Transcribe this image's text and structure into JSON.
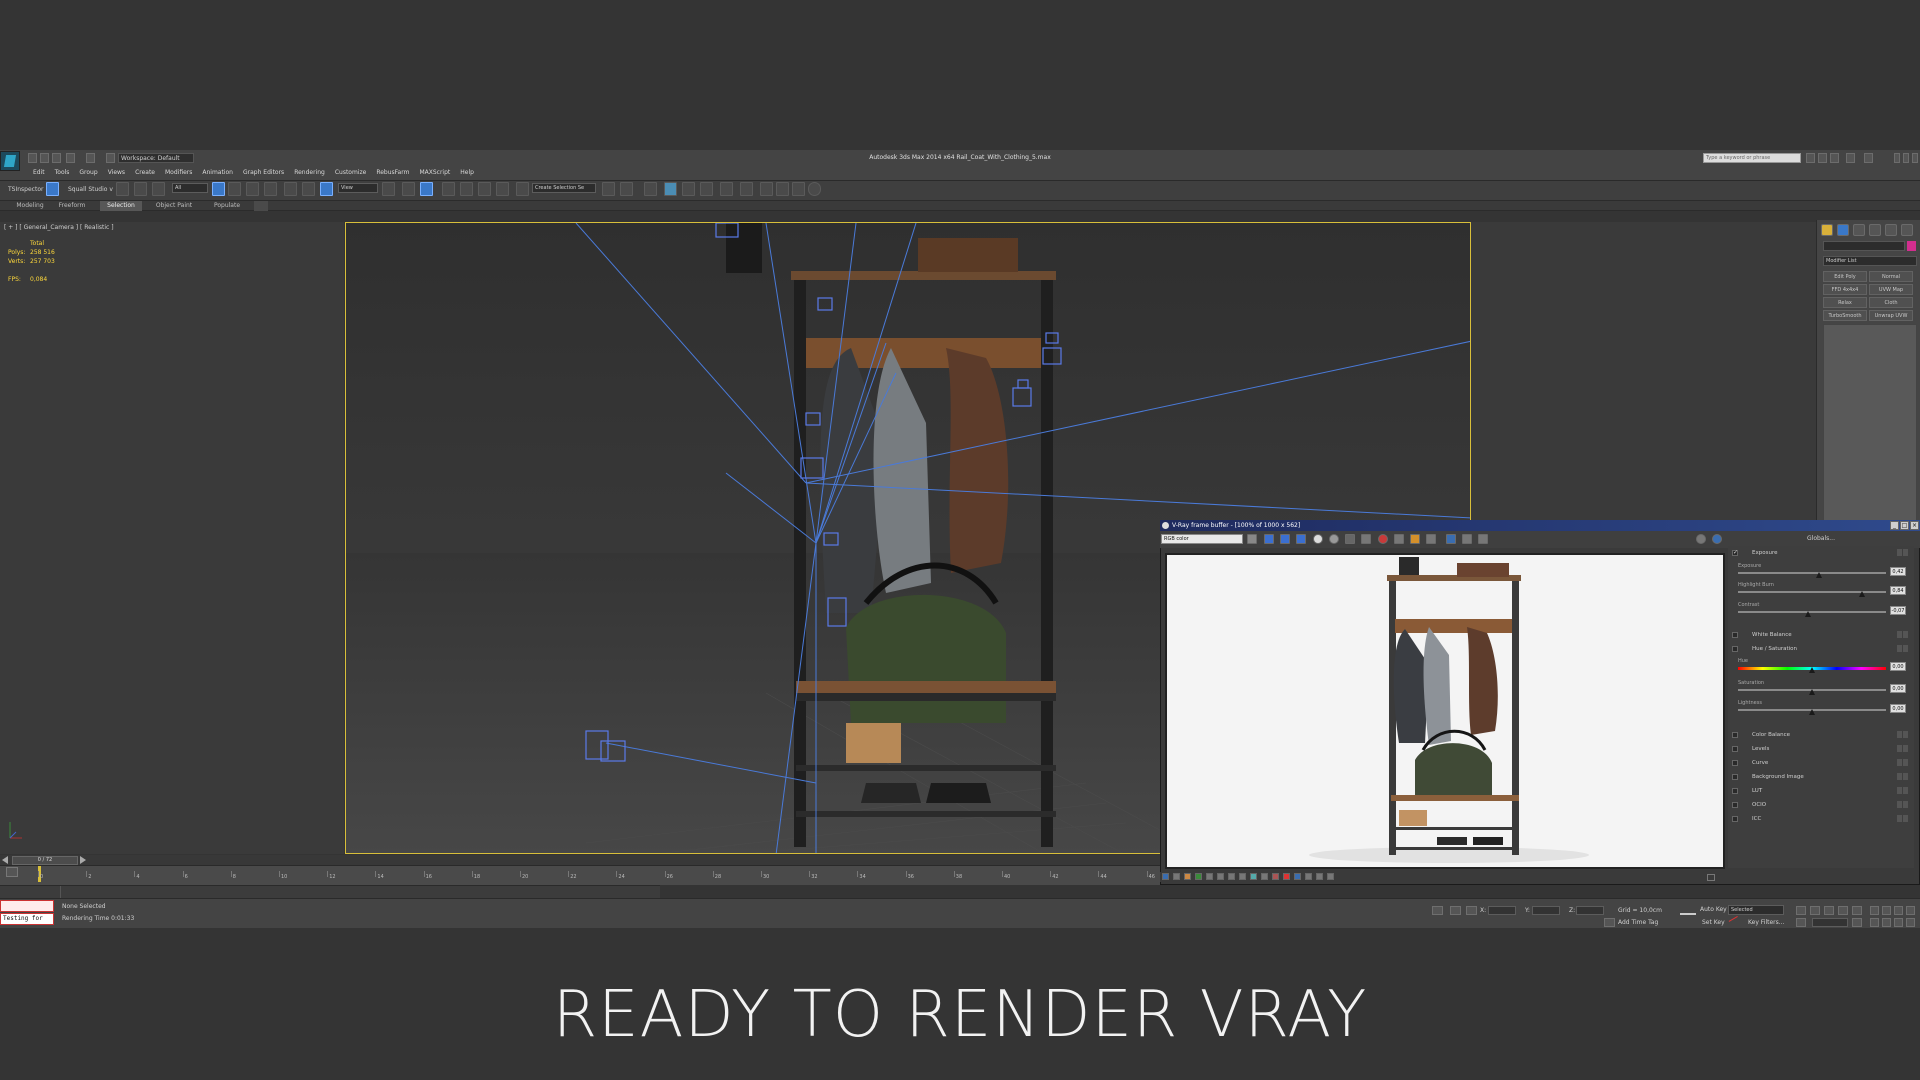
{
  "app": {
    "title": "Autodesk 3ds Max  2014 x64     Rail_Coat_With_Clothing_5.max",
    "workspace": "Workspace: Default",
    "search_placeholder": "Type a keyword or phrase"
  },
  "menu": [
    "Edit",
    "Tools",
    "Group",
    "Views",
    "Create",
    "Modifiers",
    "Animation",
    "Graph Editors",
    "Rendering",
    "Customize",
    "RebusFarm",
    "MAXScript",
    "Help"
  ],
  "toolbar": {
    "plugin1": "TSInspector",
    "plugin2": "Squall Studio v",
    "filter": "All",
    "refcoord": "View",
    "selset": "Create Selection Se"
  },
  "ribbon_tabs": [
    "Modeling",
    "Freeform",
    "Selection",
    "Object Paint",
    "Populate"
  ],
  "viewport": {
    "label": "[ + ] [ General_Camera ] [ Realistic ]",
    "stats": [
      {
        "k": "",
        "v": "Total"
      },
      {
        "k": "Polys:",
        "v": "258 516"
      },
      {
        "k": "Verts:",
        "v": "257 703"
      },
      {
        "k": "",
        "v": ""
      },
      {
        "k": "FPS:",
        "v": "0,084"
      }
    ]
  },
  "command_panel": {
    "modifier_list": "Modifier List",
    "buttons": [
      "Edit Poly",
      "Normal",
      "FFD 4x4x4",
      "UVW Map",
      "Relax",
      "Cloth",
      "TurboSmooth",
      "Unwrap UVW"
    ]
  },
  "vfb": {
    "title": "V-Ray frame buffer - [100% of 1000 x 562]",
    "channel": "RGB color",
    "globals": "Globals...",
    "rows": [
      {
        "label": "Exposure",
        "checked": true
      },
      {
        "label": "White Balance",
        "checked": false
      },
      {
        "label": "Hue / Saturation",
        "checked": false
      },
      {
        "label": "Color Balance",
        "checked": false
      },
      {
        "label": "Levels",
        "checked": false
      },
      {
        "label": "Curve",
        "checked": false
      },
      {
        "label": "Background Image",
        "checked": false
      },
      {
        "label": "LUT",
        "checked": false
      },
      {
        "label": "OCIO",
        "checked": false
      },
      {
        "label": "ICC",
        "checked": false
      }
    ],
    "exposure_sliders": [
      {
        "label": "Exposure",
        "value": "0,42",
        "pos": 0.55
      },
      {
        "label": "Highlight Burn",
        "value": "0,84",
        "pos": 0.84
      },
      {
        "label": "Contrast",
        "value": "-0,07",
        "pos": 0.47
      }
    ],
    "hue_sliders": [
      {
        "label": "Hue",
        "value": "0,00",
        "pos": 0.5
      },
      {
        "label": "Saturation",
        "value": "0,00",
        "pos": 0.5
      },
      {
        "label": "Lightness",
        "value": "0,00",
        "pos": 0.5
      }
    ]
  },
  "timeline": {
    "frame_counter": "0 / 72",
    "ticks": [
      "0",
      "2",
      "4",
      "6",
      "8",
      "10",
      "12",
      "14",
      "16",
      "18",
      "20",
      "22",
      "24",
      "26",
      "28",
      "30",
      "32",
      "34",
      "36",
      "38",
      "40",
      "42",
      "44",
      "46"
    ]
  },
  "status": {
    "maxscript": "Testing for",
    "selection": "None Selected",
    "render_time": "Rendering Time  0:01:33",
    "grid": "Grid = 10,0cm",
    "add_time_tag": "Add Time Tag",
    "auto_key": "Auto Key",
    "set_key": "Set Key",
    "selected": "Selected",
    "key_filters": "Key Filters...",
    "x_label": "X:",
    "y_label": "Y:",
    "z_label": "Z:"
  },
  "banner": "READY TO RENDER VRAY",
  "colors": {
    "accent": "#d8bf3a",
    "stats": "#ffd93b",
    "vfb_title": "#2f4a8c"
  }
}
